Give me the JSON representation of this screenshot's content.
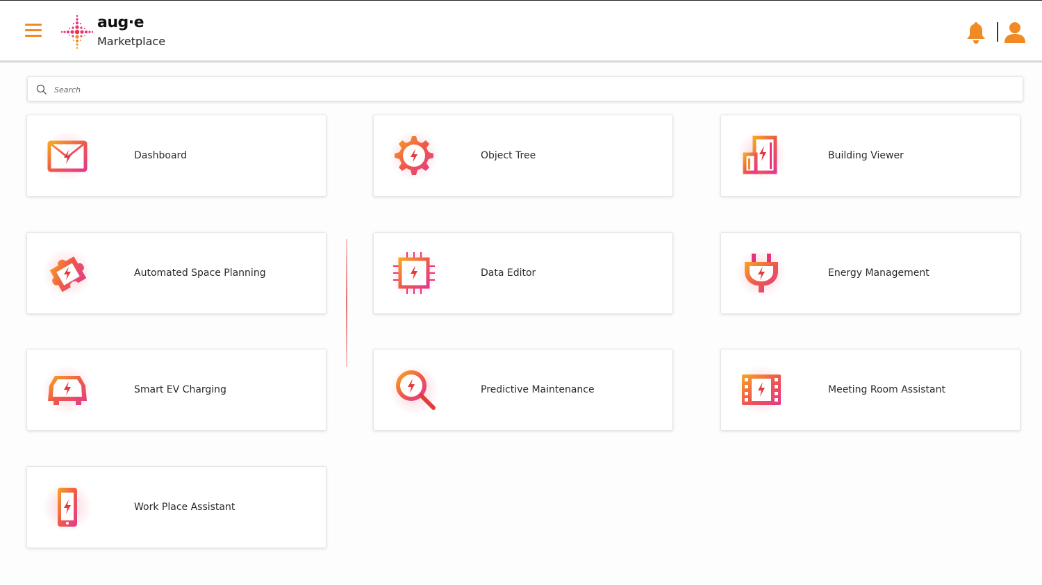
{
  "header": {
    "brand_name": "aug·e",
    "brand_subtitle": "Marketplace",
    "menu_icon": "hamburger-icon",
    "notification_icon": "bell-icon",
    "profile_icon": "user-icon"
  },
  "search": {
    "placeholder": "Search",
    "value": ""
  },
  "apps": [
    {
      "label": "Dashboard",
      "icon": "envelope-bolt-icon"
    },
    {
      "label": "Object Tree",
      "icon": "gear-bolt-icon"
    },
    {
      "label": "Building Viewer",
      "icon": "building-bolt-icon"
    },
    {
      "label": "Automated Space Planning",
      "icon": "puzzle-bolt-icon"
    },
    {
      "label": "Data Editor",
      "icon": "chip-bolt-icon"
    },
    {
      "label": "Energy Management",
      "icon": "plug-bolt-icon"
    },
    {
      "label": "Smart EV Charging",
      "icon": "car-bolt-icon"
    },
    {
      "label": "Predictive Maintenance",
      "icon": "magnifier-bolt-icon"
    },
    {
      "label": "Meeting Room Assistant",
      "icon": "filmstrip-bolt-icon"
    },
    {
      "label": "Work Place Assistant",
      "icon": "phone-bolt-icon"
    }
  ],
  "colors": {
    "accent_orange": "#f08a24",
    "accent_pink": "#e8327c",
    "accent_red": "#e23b3b"
  }
}
